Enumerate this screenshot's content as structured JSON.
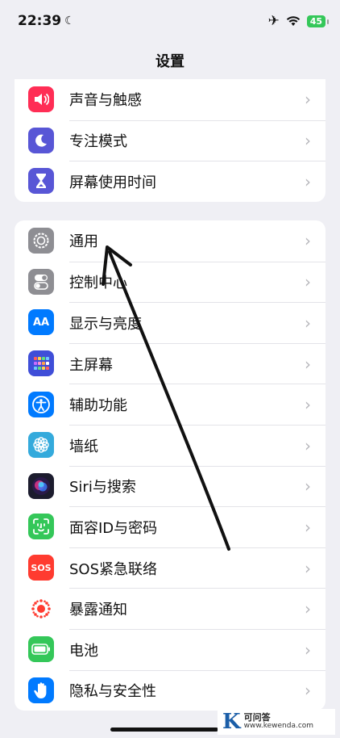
{
  "status": {
    "time": "22:39",
    "battery": "45"
  },
  "nav": {
    "title": "设置"
  },
  "top_group": [
    {
      "label": "声音与触感",
      "icon": "speaker-icon",
      "color": "#ff2d55"
    },
    {
      "label": "专注模式",
      "icon": "moon-icon",
      "color": "#5856d6"
    },
    {
      "label": "屏幕使用时间",
      "icon": "hourglass-icon",
      "color": "#5856d6"
    }
  ],
  "main_group": [
    {
      "label": "通用",
      "icon": "gear-icon",
      "color": "#8e8e93"
    },
    {
      "label": "控制中心",
      "icon": "toggles-icon",
      "color": "#8e8e93"
    },
    {
      "label": "显示与亮度",
      "icon": "text-size-icon",
      "color": "#007aff"
    },
    {
      "label": "主屏幕",
      "icon": "home-grid-icon",
      "color": "#3f4ed8"
    },
    {
      "label": "辅助功能",
      "icon": "accessibility-icon",
      "color": "#007aff"
    },
    {
      "label": "墙纸",
      "icon": "flower-icon",
      "color": "#34aadc"
    },
    {
      "label": "Siri与搜索",
      "icon": "siri-icon",
      "color": "#222"
    },
    {
      "label": "面容ID与密码",
      "icon": "face-id-icon",
      "color": "#34c759"
    },
    {
      "label": "SOS紧急联络",
      "icon": "sos-icon",
      "color": "#ff3b30"
    },
    {
      "label": "暴露通知",
      "icon": "exposure-icon",
      "color": "#ffffff"
    },
    {
      "label": "电池",
      "icon": "battery-icon",
      "color": "#34c759"
    },
    {
      "label": "隐私与安全性",
      "icon": "hand-icon",
      "color": "#007aff"
    }
  ],
  "icon_text": {
    "aa": "AA",
    "sos": "SOS"
  },
  "watermark": {
    "letter": "K",
    "cn": "可问答",
    "url": "www.kewenda.com"
  }
}
